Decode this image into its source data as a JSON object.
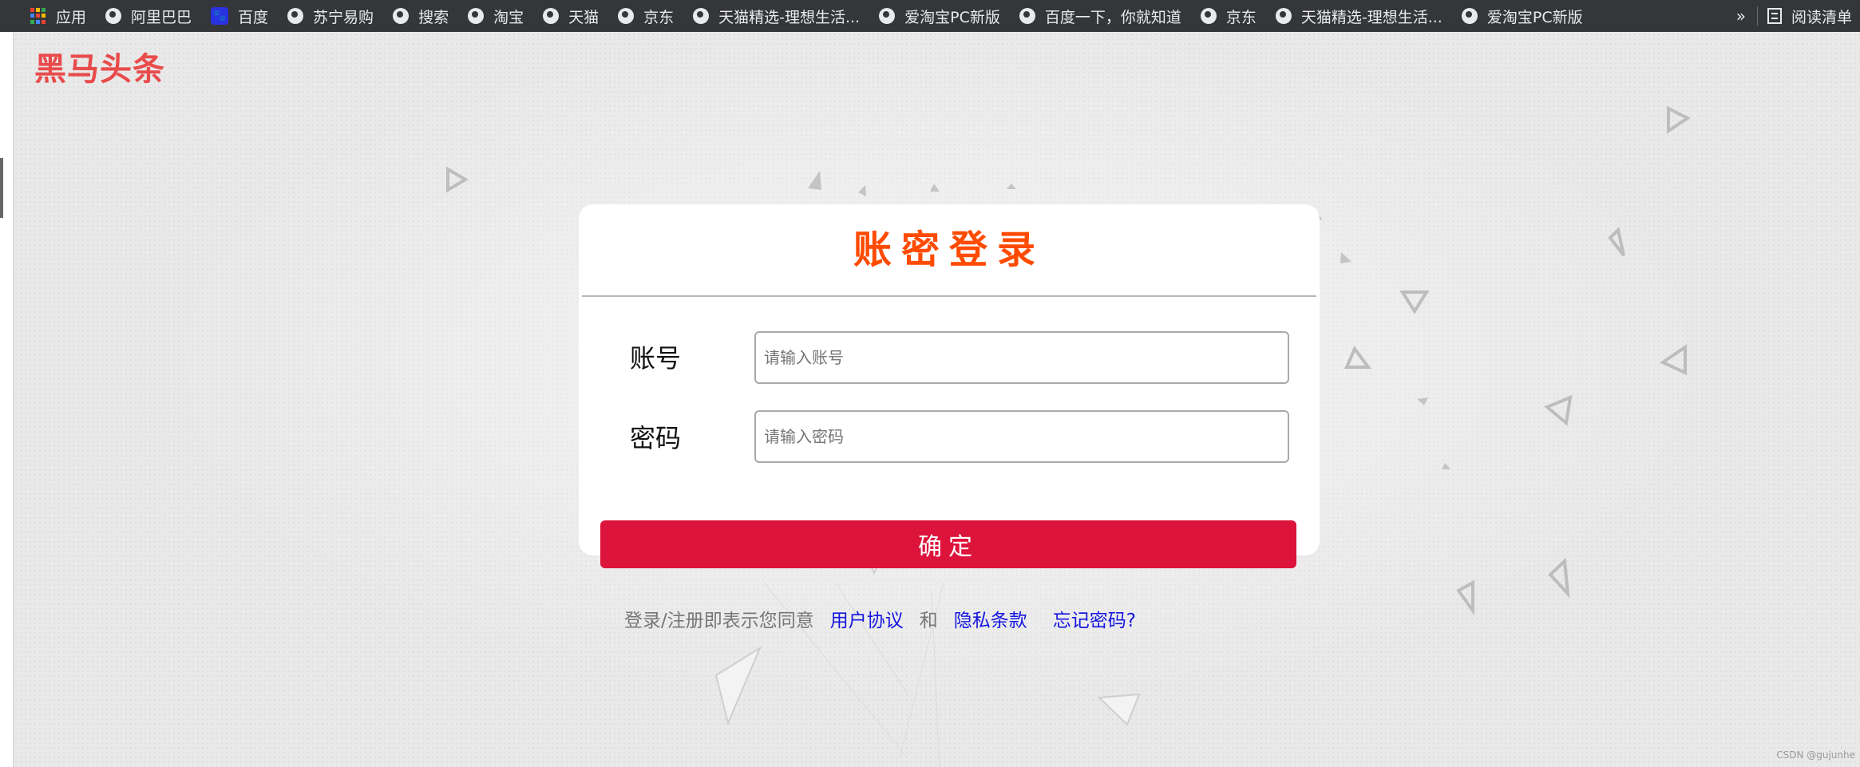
{
  "bookmarks_bar": {
    "apps_label": "应用",
    "items": [
      {
        "label": "阿里巴巴",
        "icon": "globe-icon"
      },
      {
        "label": "百度",
        "icon": "baidu-icon"
      },
      {
        "label": "苏宁易购",
        "icon": "globe-icon"
      },
      {
        "label": "搜索",
        "icon": "globe-icon"
      },
      {
        "label": "淘宝",
        "icon": "globe-icon"
      },
      {
        "label": "天猫",
        "icon": "globe-icon"
      },
      {
        "label": "京东",
        "icon": "globe-icon"
      },
      {
        "label": "天猫精选-理想生活...",
        "icon": "globe-icon"
      },
      {
        "label": "爱淘宝PC新版",
        "icon": "globe-icon"
      },
      {
        "label": "百度一下，你就知道",
        "icon": "globe-icon"
      },
      {
        "label": "京东",
        "icon": "globe-icon"
      },
      {
        "label": "天猫精选-理想生活...",
        "icon": "globe-icon"
      },
      {
        "label": "爱淘宝PC新版",
        "icon": "globe-icon"
      }
    ],
    "more": "»",
    "reading_list": "阅读清单"
  },
  "brand": "黑马头条",
  "login_card": {
    "title": "账密登录",
    "account_label": "账号",
    "account_placeholder": "请输入账号",
    "account_value": "",
    "password_label": "密码",
    "password_placeholder": "请输入密码",
    "password_value": "",
    "submit_label": "确定"
  },
  "agreement": {
    "prefix": "登录/注册即表示您同意",
    "user_agreement": "用户协议",
    "and": "和",
    "privacy": "隐私条款",
    "forgot_password": "忘记密码?"
  },
  "watermark": "CSDN @gujunhe",
  "colors": {
    "brand": "#e94b4b",
    "title": "#ff4b00",
    "submit_bg": "#dc143c",
    "link": "#1515e0",
    "bookmarks_bg": "#35363a"
  }
}
